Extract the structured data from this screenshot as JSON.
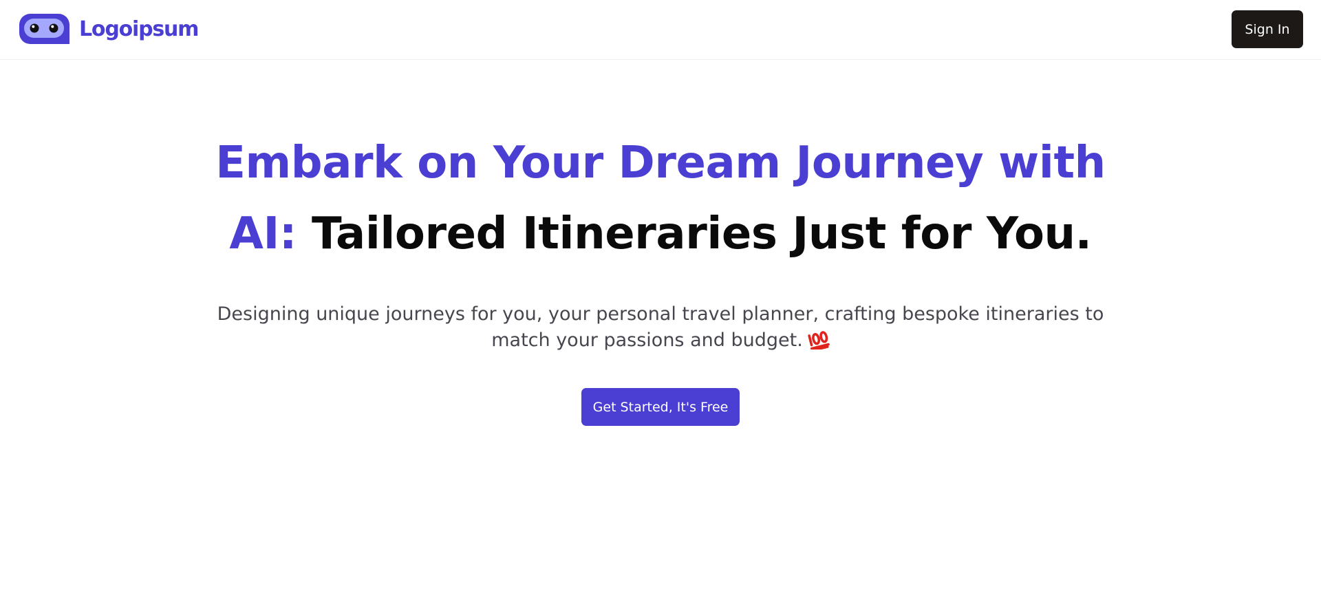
{
  "brand": {
    "name": "Logoipsum",
    "logo_icon": "robot-face-icon",
    "color": "#4a3fd2"
  },
  "header": {
    "signin_label": "Sign In",
    "signin_color": "#1c1917"
  },
  "hero": {
    "title_accent": "Embark on Your Dream Journey with AI:",
    "title_rest": "Tailored Itineraries Just for You.",
    "subtitle": "Designing unique journeys for you, your personal travel planner, crafting bespoke itineraries to match your passions and budget.",
    "subtitle_emoji": "hundred-points-icon",
    "cta_label": "Get Started, It's Free"
  }
}
